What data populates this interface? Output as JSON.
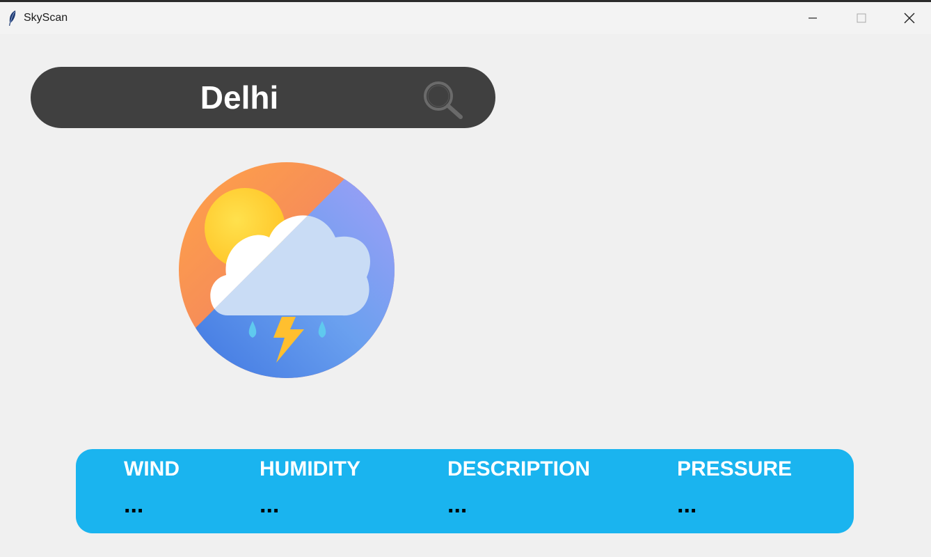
{
  "window": {
    "title": "SkyScan"
  },
  "search": {
    "value": "Delhi"
  },
  "info": {
    "wind": {
      "label": "WIND",
      "value": "..."
    },
    "humidity": {
      "label": "HUMIDITY",
      "value": "..."
    },
    "description": {
      "label": "DESCRIPTION",
      "value": "..."
    },
    "pressure": {
      "label": "PRESSURE",
      "value": "..."
    }
  },
  "colors": {
    "search_bar": "#404040",
    "info_panel": "#1ab4ef",
    "background": "#f0f0f0"
  },
  "icons": {
    "app": "feather-icon",
    "search": "search-icon",
    "weather": "thunderstorm-icon"
  }
}
